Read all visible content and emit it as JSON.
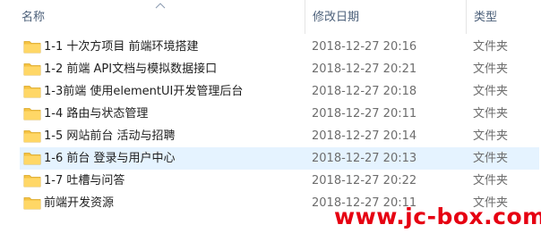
{
  "columns": {
    "name": "名称",
    "modified": "修改日期",
    "type": "类型"
  },
  "sort": {
    "column": "name",
    "direction": "ascending"
  },
  "colors": {
    "folder": "#f5c242",
    "selection": "#e5f3ff",
    "watermark": "#e60012"
  },
  "rows": [
    {
      "name": "1-1 十次方项目 前端环境搭建",
      "date": "2018-12-27 20:16",
      "type": "文件夹",
      "icon": "folder-icon",
      "selected": false
    },
    {
      "name": "1-2 前端 API文档与模拟数据接口",
      "date": "2018-12-27 20:21",
      "type": "文件夹",
      "icon": "folder-icon",
      "selected": false
    },
    {
      "name": "1-3前端 使用elementUI开发管理后台",
      "date": "2018-12-27 20:18",
      "type": "文件夹",
      "icon": "folder-icon",
      "selected": false
    },
    {
      "name": "1-4 路由与状态管理",
      "date": "2018-12-27 20:11",
      "type": "文件夹",
      "icon": "folder-icon",
      "selected": false
    },
    {
      "name": "1-5 网站前台 活动与招聘",
      "date": "2018-12-27 20:14",
      "type": "文件夹",
      "icon": "folder-icon",
      "selected": false
    },
    {
      "name": "1-6 前台 登录与用户中心",
      "date": "2018-12-27 20:13",
      "type": "文件夹",
      "icon": "folder-icon",
      "selected": true
    },
    {
      "name": "1-7 吐槽与问答",
      "date": "2018-12-27 20:22",
      "type": "文件夹",
      "icon": "folder-icon",
      "selected": false
    },
    {
      "name": "前端开发资源",
      "date": "2018-12-27 20:11",
      "type": "文件夹",
      "icon": "folder-icon",
      "selected": false
    }
  ],
  "watermark": "www.jc-box.com"
}
